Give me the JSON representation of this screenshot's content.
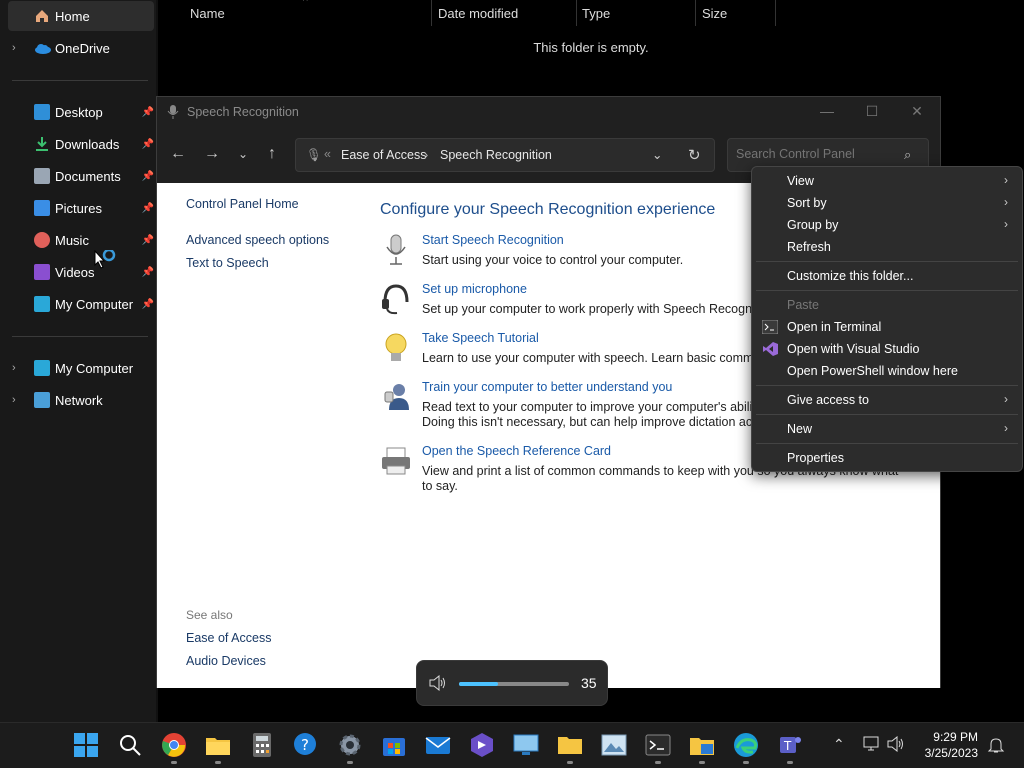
{
  "explorer": {
    "sidebar": {
      "items": [
        {
          "label": "Home"
        },
        {
          "label": "OneDrive"
        },
        {
          "label": "Desktop"
        },
        {
          "label": "Downloads"
        },
        {
          "label": "Documents"
        },
        {
          "label": "Pictures"
        },
        {
          "label": "Music"
        },
        {
          "label": "Videos"
        },
        {
          "label": "My Computer"
        },
        {
          "label": "My Computer"
        },
        {
          "label": "Network"
        }
      ]
    },
    "columns": [
      "Name",
      "Date modified",
      "Type",
      "Size"
    ],
    "empty_message": "This folder is empty."
  },
  "speech_window": {
    "title": "Speech Recognition",
    "breadcrumb": [
      "Ease of Access",
      "Speech Recognition"
    ],
    "search_placeholder": "Search Control Panel",
    "left_links": [
      "Control Panel Home",
      "Advanced speech options",
      "Text to Speech"
    ],
    "see_also_label": "See also",
    "see_also_links": [
      "Ease of Access",
      "Audio Devices"
    ],
    "heading": "Configure your Speech Recognition experience",
    "tasks": [
      {
        "link": "Start Speech Recognition",
        "desc": "Start using your voice to control your computer."
      },
      {
        "link": "Set up microphone",
        "desc": "Set up your computer to work properly with Speech Recognition."
      },
      {
        "link": "Take Speech Tutorial",
        "desc": "Learn to use your computer with speech.  Learn basic commands and dictation."
      },
      {
        "link": "Train your computer to better understand you",
        "desc": "Read text to your computer to improve your computer's ability to understand your voice. Doing this isn't necessary, but can help improve dictation accuracy."
      },
      {
        "link": "Open the Speech Reference Card",
        "desc": "View and print a list of common commands to keep with you so you always know what to say."
      }
    ]
  },
  "context_menu": {
    "items": [
      {
        "label": "View"
      },
      {
        "label": "Sort by"
      },
      {
        "label": "Group by"
      },
      {
        "label": "Refresh"
      },
      {
        "label": "Customize this folder..."
      },
      {
        "label": "Paste"
      },
      {
        "label": "Open in Terminal"
      },
      {
        "label": "Open with Visual Studio"
      },
      {
        "label": "Open PowerShell window here"
      },
      {
        "label": "Give access to"
      },
      {
        "label": "New"
      },
      {
        "label": "Properties"
      }
    ]
  },
  "volume": {
    "value": "35",
    "level": 0.35
  },
  "taskbar": {
    "time": "9:29 PM",
    "date": "3/25/2023"
  },
  "colors": {
    "accent": "#4cc2ff",
    "link": "#1a5aa8",
    "heading": "#1e4e8c"
  }
}
